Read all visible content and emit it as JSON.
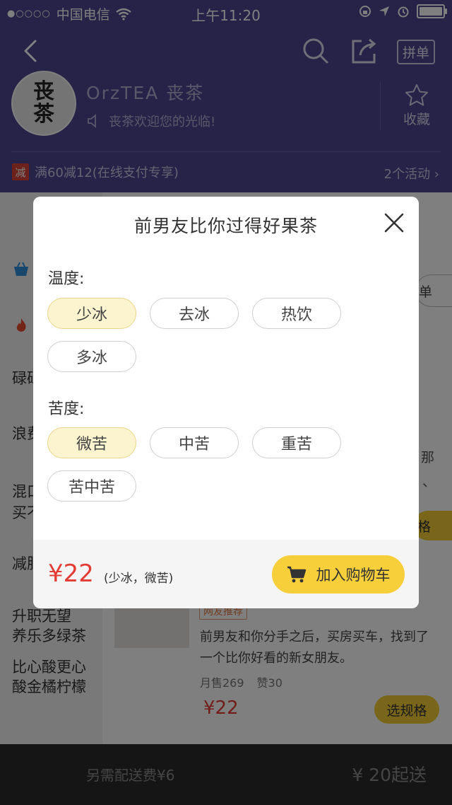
{
  "status_bar": {
    "carrier": "中国电信",
    "time": "上午11:20",
    "signal_dots": "●○○○○"
  },
  "header": {
    "pindan_label": "拼单",
    "logo_line1": "丧",
    "logo_line2": "茶",
    "store_name": "OrzTEA 丧茶",
    "welcome": "丧茶欢迎您的光临!",
    "favorite_label": "收藏",
    "promo_badge": "减",
    "promo_text": "满60减12(在线支付专享)",
    "activities": "2个活动 ›"
  },
  "menu": {
    "items": [
      {
        "label": "碌碌"
      },
      {
        "label": "浪费"
      },
      {
        "label": "混口"
      },
      {
        "label": "买不"
      },
      {
        "label": "减肥"
      },
      {
        "label": "升职无望"
      },
      {
        "label": "养乐多绿茶"
      },
      {
        "label": "比心酸更心"
      },
      {
        "label": "酸金橘柠檬"
      }
    ]
  },
  "content": {
    "peek_text_1": "单",
    "peek_text_2": "那",
    "peek_text_3": "、",
    "peek_btn_2": "格",
    "dish": {
      "tag": "网友推荐",
      "desc": "前男友和你分手之后，买房买车，找到了一个比你好看的新女朋友。",
      "sales": "月售269",
      "likes": "赞30",
      "price": "¥22",
      "select_label": "选规格"
    }
  },
  "modal": {
    "title": "前男友比你过得好果茶",
    "temperature_label": "温度:",
    "temperature_options": [
      "少冰",
      "去冰",
      "热饮",
      "多冰"
    ],
    "bitterness_label": "苦度:",
    "bitterness_options": [
      "微苦",
      "中苦",
      "重苦",
      "苦中苦"
    ],
    "price": "¥22",
    "spec": "(少冰，微苦)",
    "add_to_cart": "加入购物车"
  },
  "bottom_bar": {
    "delivery_fee": "另需配送费¥6",
    "min_order": "¥ 20起送"
  },
  "colors": {
    "header_bg": "#4f4790",
    "accent_yellow": "#f7cf3a",
    "price_red": "#e23c34",
    "selected_bg": "#fcf4cf"
  }
}
